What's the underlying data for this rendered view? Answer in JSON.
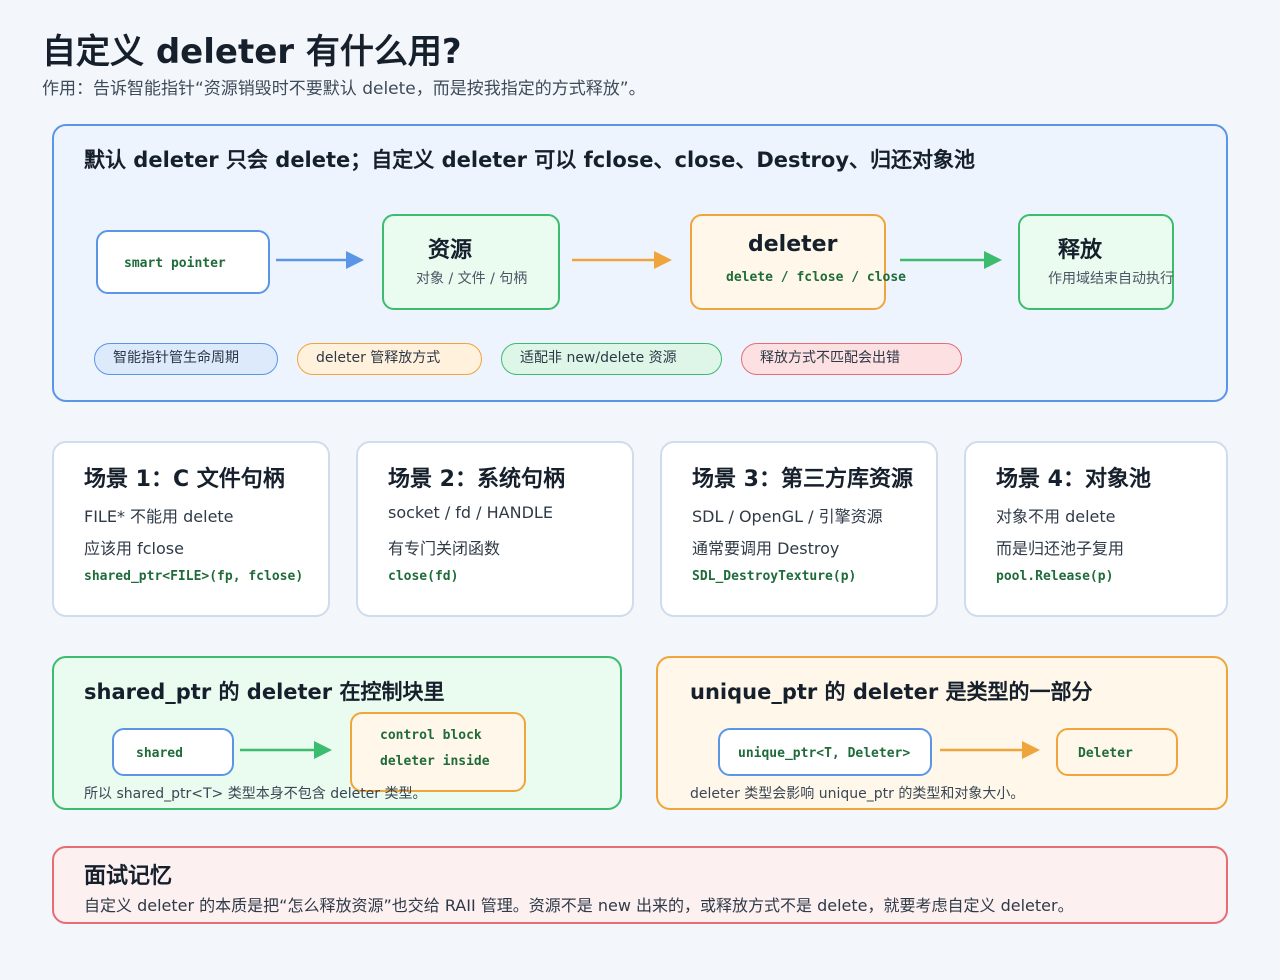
{
  "header": {
    "title": "自定义 deleter 有什么用?",
    "subtitle": "作用：告诉智能指针“资源销毁时不要默认 delete，而是按我指定的方式释放”。"
  },
  "overview": {
    "heading": "默认 deleter 只会 delete；自定义 deleter 可以 fclose、close、Destroy、归还对象池",
    "nodes": [
      {
        "code": "smart pointer"
      },
      {
        "title": "资源",
        "sub": "对象 / 文件 / 句柄"
      },
      {
        "title": "deleter",
        "code": "delete / fclose / close"
      },
      {
        "title": "释放",
        "sub": "作用域结束自动执行"
      }
    ],
    "pills": [
      "智能指针管生命周期",
      "deleter 管释放方式",
      "适配非 new/delete 资源",
      "释放方式不匹配会出错"
    ]
  },
  "scenarios": [
    {
      "title": "场景 1：C 文件句柄",
      "line1": "FILE* 不能用 delete",
      "line2": "应该用 fclose",
      "code": "shared_ptr<FILE>(fp, fclose)"
    },
    {
      "title": "场景 2：系统句柄",
      "line1": "socket / fd / HANDLE",
      "line2": "有专门关闭函数",
      "code": "close(fd)"
    },
    {
      "title": "场景 3：第三方库资源",
      "line1": "SDL / OpenGL / 引擎资源",
      "line2": "通常要调用 Destroy",
      "code": "SDL_DestroyTexture(p)"
    },
    {
      "title": "场景 4：对象池",
      "line1": "对象不用 delete",
      "line2": "而是归还池子复用",
      "code": "pool.Release(p)"
    }
  ],
  "shared_panel": {
    "heading": "shared_ptr 的 deleter 在控制块里",
    "left_box": "shared",
    "right_line1": "control block",
    "right_line2": "deleter inside",
    "note": "所以 shared_ptr<T> 类型本身不包含 deleter 类型。"
  },
  "unique_panel": {
    "heading": "unique_ptr 的 deleter 是类型的一部分",
    "left_box": "unique_ptr<T, Deleter>",
    "right_box": "Deleter",
    "note": "deleter 类型会影响 unique_ptr 的类型和对象大小。"
  },
  "memory": {
    "heading": "面试记忆",
    "text": "自定义 deleter 的本质是把“怎么释放资源”也交给 RAII 管理。资源不是 new 出来的，或释放方式不是 delete，就要考虑自定义 deleter。"
  },
  "colors": {
    "blue": "#5a95e6",
    "green": "#3dbb6e",
    "orange": "#f0a53c",
    "red": "#e86d72"
  }
}
